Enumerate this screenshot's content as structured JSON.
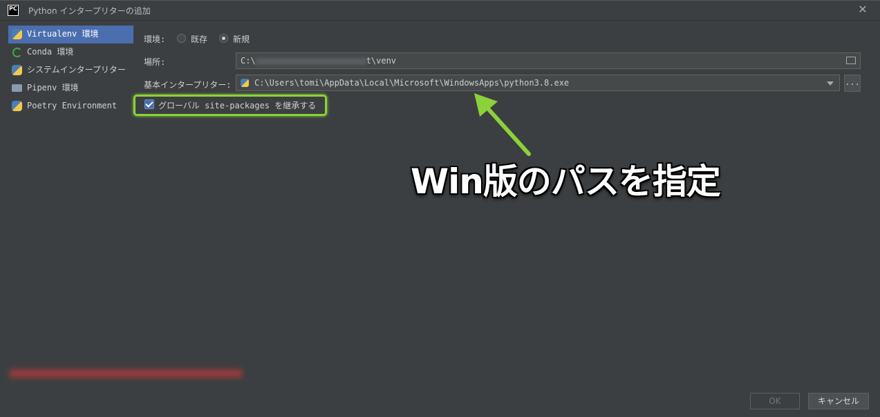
{
  "window": {
    "logo_text": "PC",
    "title": "Python インタープリターの追加",
    "close_glyph": "✕"
  },
  "sidebar": {
    "items": [
      {
        "label": "Virtualenv 環境",
        "icon": "python-icon",
        "selected": true
      },
      {
        "label": "Conda 環境",
        "icon": "conda-icon",
        "selected": false
      },
      {
        "label": "システムインタープリター",
        "icon": "python-icon",
        "selected": false
      },
      {
        "label": "Pipenv 環境",
        "icon": "folder-icon",
        "selected": false
      },
      {
        "label": "Poetry Environment",
        "icon": "python-icon",
        "selected": false
      }
    ]
  },
  "form": {
    "env_label": "環境:",
    "env_existing": "既存",
    "env_new": "新規",
    "env_selected": "新規",
    "location_label": "場所:",
    "location_prefix": "C:\\",
    "location_suffix": "t\\venv",
    "base_interpreter_label": "基本インタープリター:",
    "base_interpreter_value": "C:\\Users\\tomi\\AppData\\Local\\Microsoft\\WindowsApps\\python3.8.exe",
    "ellipsis": "...",
    "inherit_label": "グローバル site-packages を継承する",
    "inherit_checked": true
  },
  "annotation": {
    "text": "Win版のパスを指定",
    "arrow_color": "#8bd23a"
  },
  "buttons": {
    "ok": "OK",
    "cancel": "キャンセル"
  }
}
